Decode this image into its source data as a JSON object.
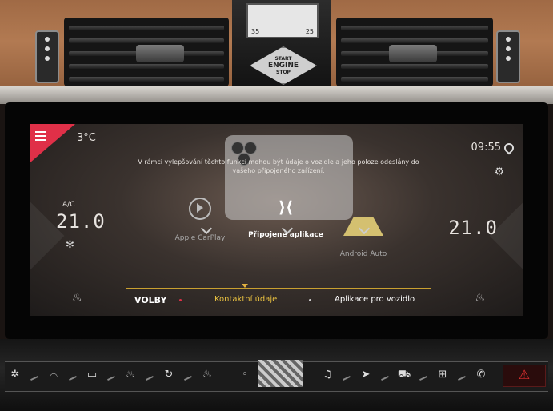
{
  "clock": {
    "left_label": "35",
    "right_label": "25"
  },
  "start_button": {
    "line1": "START",
    "line2": "ENGINE",
    "line3": "STOP"
  },
  "status": {
    "outside_temp": "3°C",
    "time": "09:55"
  },
  "notice": "V rámci vylepšování těchto funkcí mohou být údaje o vozidle a jeho poloze odeslány do vašeho připojeného zařízení.",
  "climate": {
    "ac_label": "A/C",
    "driver_temp": "21.0",
    "passenger_temp": "21.0"
  },
  "apps": [
    {
      "label": "Apple CarPlay",
      "icon": "play-icon"
    },
    {
      "label": "Připojené aplikace",
      "icon": "ds-logo-icon"
    },
    {
      "label": "Android Auto",
      "icon": "android-auto-icon"
    }
  ],
  "bottom_tabs": {
    "volby": "VOLBY",
    "kontaktni": "Kontaktní údaje",
    "aplikace": "Aplikace pro vozidlo"
  },
  "colors": {
    "accent": "#e8c040",
    "menu": "#e03048",
    "hazard": "#e03030"
  },
  "control_buttons": [
    "fan-icon",
    "front-defrost-icon",
    "rear-defrost-icon",
    "heated-seat-off-icon",
    "recirculation-icon",
    "seat-heat-icon",
    "music-icon",
    "navigation-icon",
    "car-icon",
    "apps-grid-icon",
    "phone-icon",
    "hazard-icon"
  ]
}
